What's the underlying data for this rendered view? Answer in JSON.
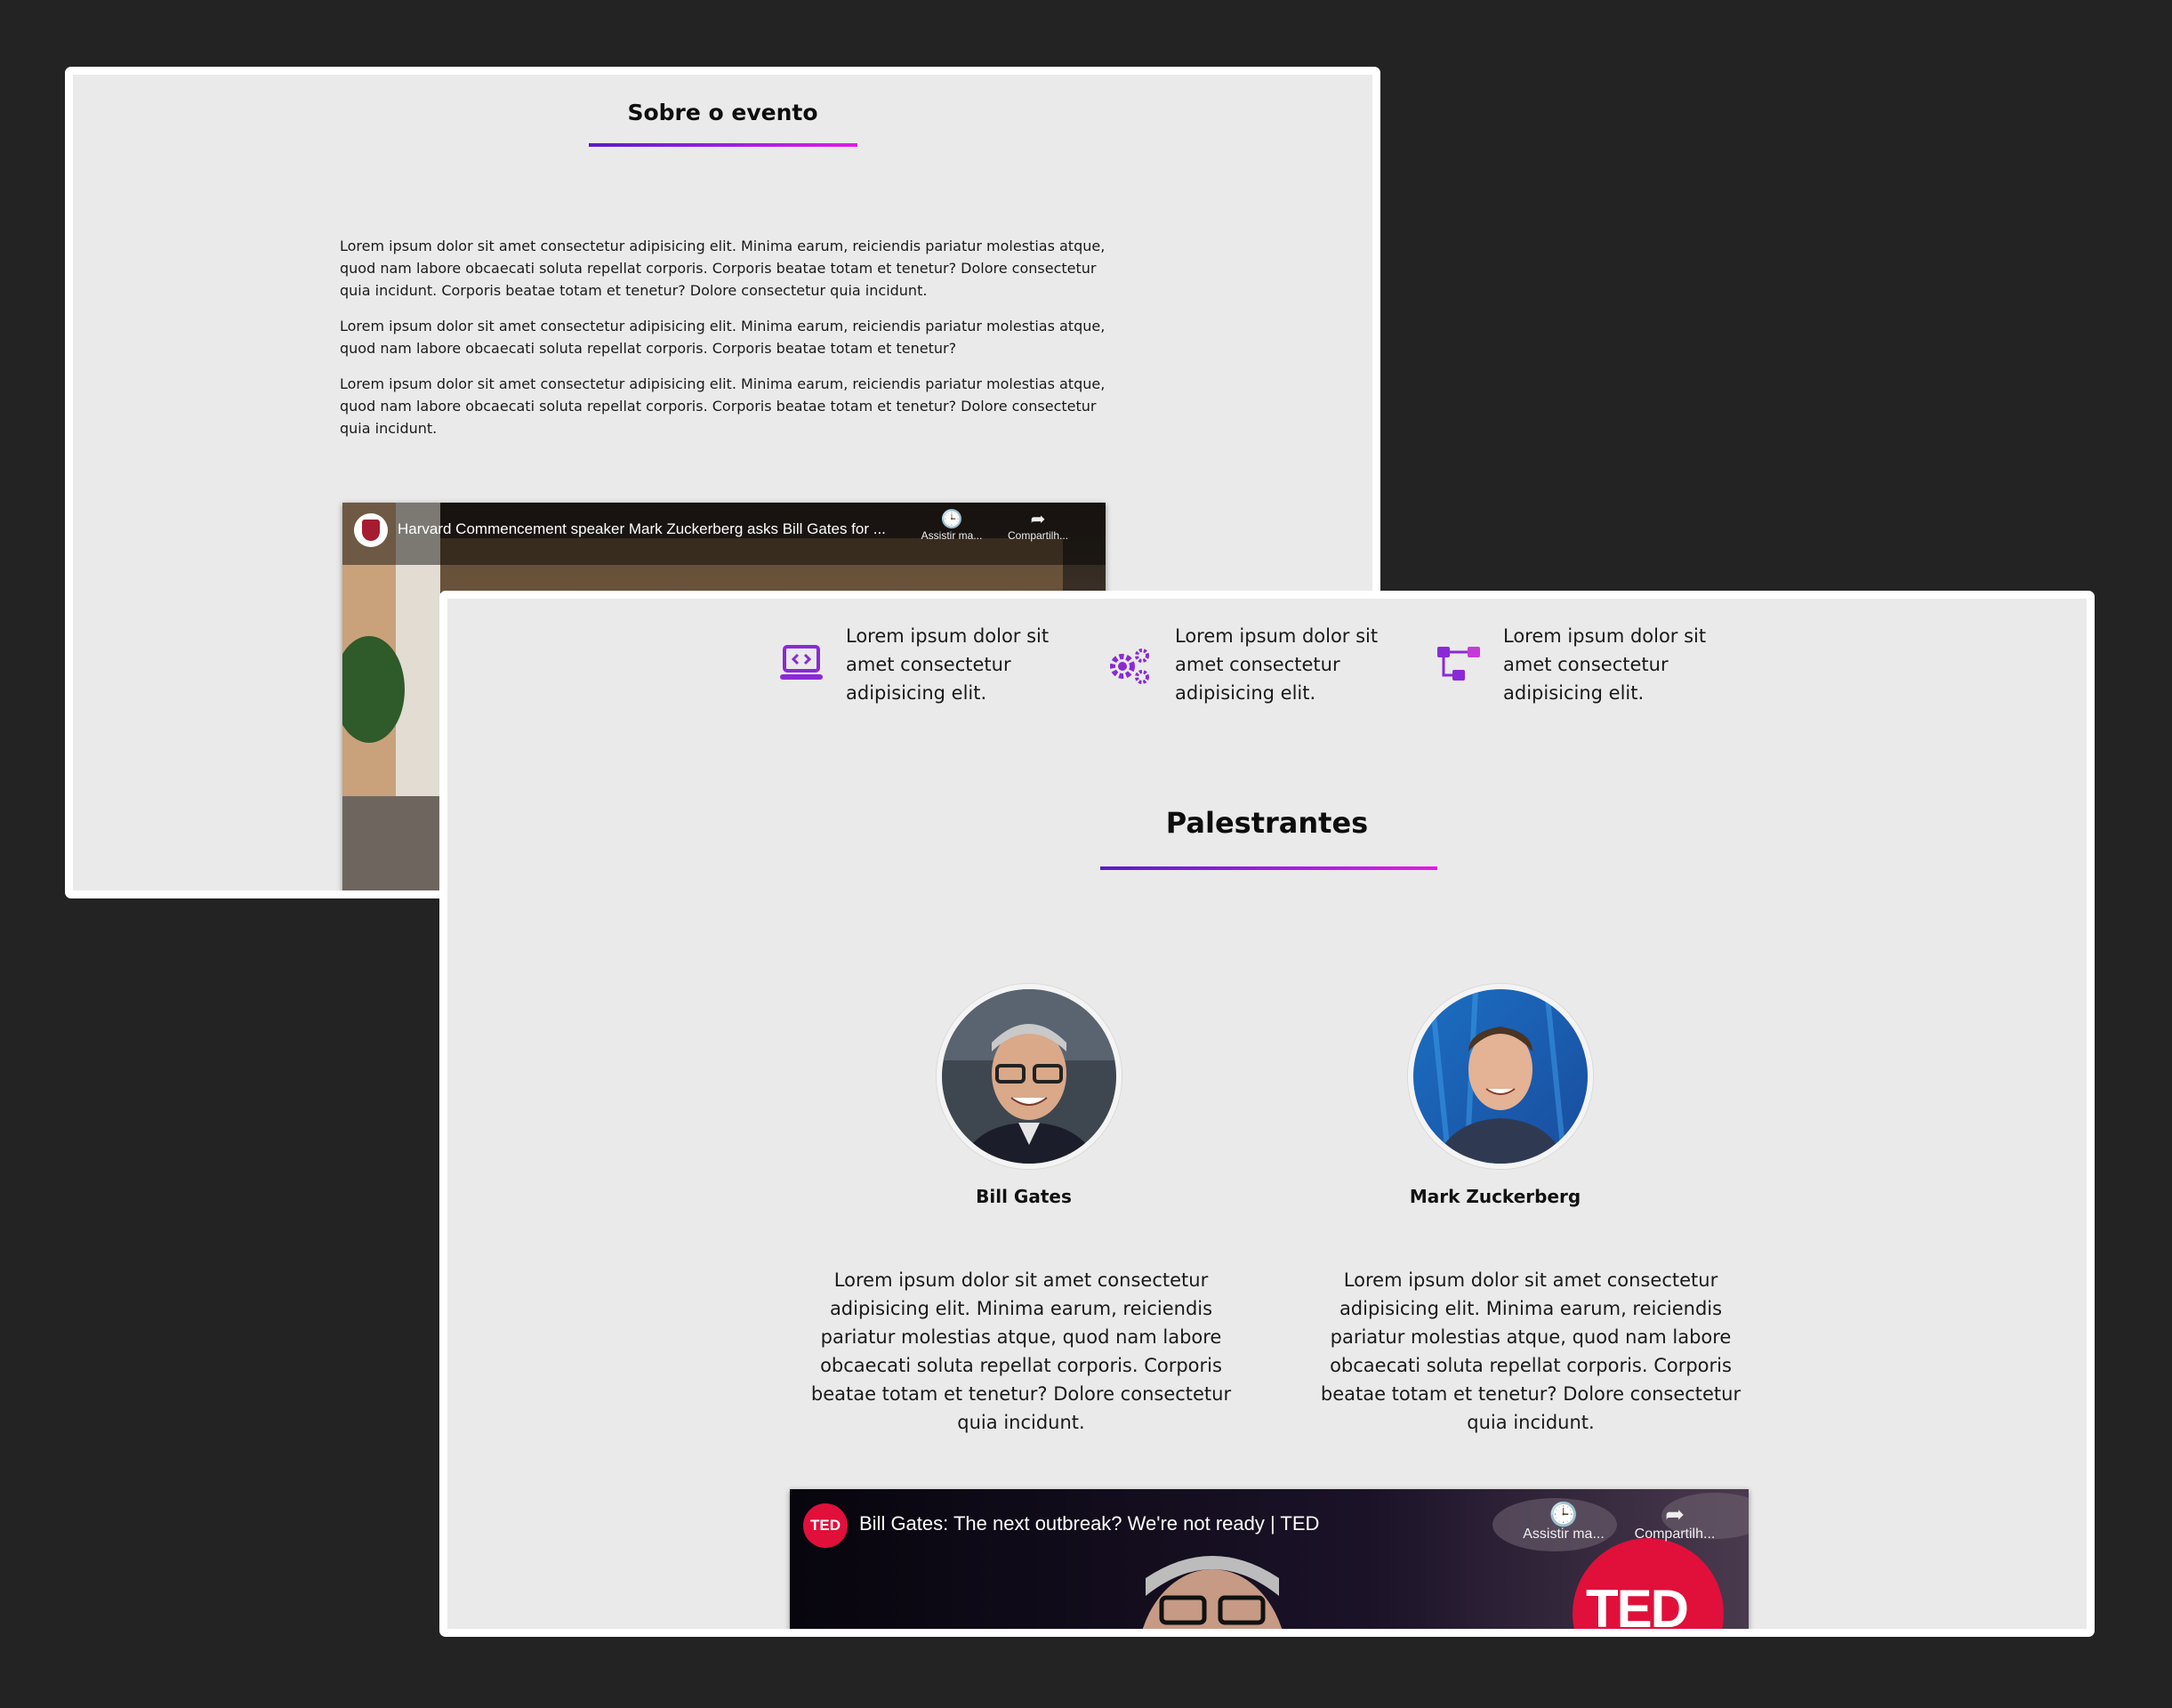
{
  "about": {
    "title": "Sobre o evento",
    "paragraphs": [
      "Lorem ipsum dolor sit amet consectetur adipisicing elit. Minima earum, reiciendis pariatur molestias atque, quod nam labore obcaecati soluta repellat corporis. Corporis beatae totam et tenetur? Dolore consectetur quia incidunt. Corporis beatae totam et tenetur? Dolore consectetur quia incidunt.",
      "Lorem ipsum dolor sit amet consectetur adipisicing elit. Minima earum, reiciendis pariatur molestias atque, quod nam labore obcaecati soluta repellat corporis. Corporis beatae totam et tenetur?",
      "Lorem ipsum dolor sit amet consectetur adipisicing elit. Minima earum, reiciendis pariatur molestias atque, quod nam labore obcaecati soluta repellat corporis. Corporis beatae totam et tenetur? Dolore consectetur quia incidunt."
    ],
    "video": {
      "title": "Harvard Commencement speaker Mark Zuckerberg asks Bill Gates for ...",
      "watch_later": "Assistir ma...",
      "share": "Compartilh..."
    }
  },
  "features": [
    {
      "icon": "laptop-code-icon",
      "text": "Lorem ipsum dolor sit amet consectetur adipisicing elit."
    },
    {
      "icon": "gears-icon",
      "text": "Lorem ipsum dolor sit amet consectetur adipisicing elit."
    },
    {
      "icon": "diagram-icon",
      "text": "Lorem ipsum dolor sit amet consectetur adipisicing elit."
    }
  ],
  "speakers": {
    "title": "Palestrantes",
    "items": [
      {
        "name": "Bill Gates",
        "bio": "Lorem ipsum dolor sit amet consectetur adipisicing elit. Minima earum, reiciendis pariatur molestias atque, quod nam labore obcaecati soluta repellat corporis. Corporis beatae totam et tenetur? Dolore consectetur quia incidunt."
      },
      {
        "name": "Mark Zuckerberg",
        "bio": "Lorem ipsum dolor sit amet consectetur adipisicing elit. Minima earum, reiciendis pariatur molestias atque, quod nam labore obcaecati soluta repellat corporis. Corporis beatae totam et tenetur? Dolore consectetur quia incidunt."
      }
    ],
    "video": {
      "channel_badge": "TED",
      "title": "Bill Gates: The next outbreak? We're not ready | TED",
      "watch_later": "Assistir ma...",
      "share": "Compartilh...",
      "thumb_logo": "TED"
    }
  },
  "colors": {
    "accent_start": "#5a1cc8",
    "accent_end": "#e21ce6",
    "icon": "#8a2ad6",
    "page_bg": "#232323",
    "panel_bg": "#eaeaea"
  }
}
